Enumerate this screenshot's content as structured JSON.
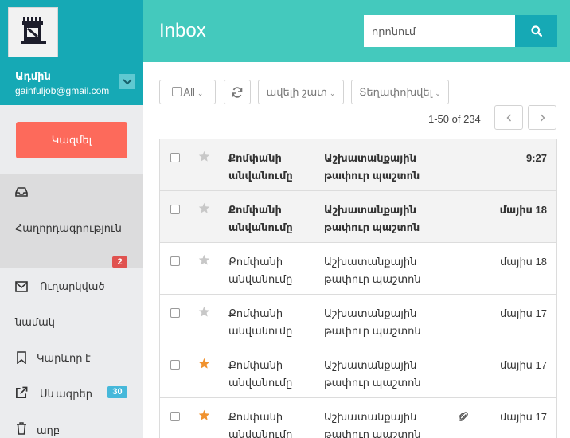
{
  "profile": {
    "name": "Ադմին",
    "email": "gainfuljob@gmail.com"
  },
  "compose": {
    "label": "Կազմել"
  },
  "nav": {
    "inbox": {
      "label": "Հաղորդագրություն",
      "badge": "2"
    },
    "sent": {
      "label_line1": "Ուղարկված",
      "label_line2": "նամակ"
    },
    "important": {
      "label": "Կարևոր է"
    },
    "drafts": {
      "label": "Սևագրեր",
      "badge": "30"
    },
    "trash": {
      "label": "աղբ"
    }
  },
  "header": {
    "title": "Inbox",
    "search_placeholder": "որոնում"
  },
  "toolbar": {
    "select_all_label": "All",
    "more_label": "ավելի շատ",
    "move_label": "Տեղափոխվել"
  },
  "pager": {
    "text": "1-50 of 234"
  },
  "mails": [
    {
      "sender_line1": "Քոմփանի",
      "sender_line2": "անվանումը",
      "subject_line1": "Աշխատանքային",
      "subject_line2": "թափուր պաշտոն",
      "date": "9:27",
      "unread": true,
      "starred": false,
      "attachment": false
    },
    {
      "sender_line1": "Քոմփանի",
      "sender_line2": "անվանումը",
      "subject_line1": "Աշխատանքային",
      "subject_line2": "թափուր պաշտոն",
      "date": "մայիս 18",
      "unread": true,
      "starred": false,
      "attachment": false
    },
    {
      "sender_line1": "Քոմփանի",
      "sender_line2": "անվանումը",
      "subject_line1": "Աշխատանքային",
      "subject_line2": "թափուր պաշտոն",
      "date": "մայիս 18",
      "unread": false,
      "starred": false,
      "attachment": false
    },
    {
      "sender_line1": "Քոմփանի",
      "sender_line2": "անվանումը",
      "subject_line1": "Աշխատանքային",
      "subject_line2": "թափուր պաշտոն",
      "date": "մայիս 17",
      "unread": false,
      "starred": false,
      "attachment": false
    },
    {
      "sender_line1": "Քոմփանի",
      "sender_line2": "անվանումը",
      "subject_line1": "Աշխատանքային",
      "subject_line2": "թափուր պաշտոն",
      "date": "մայիս 17",
      "unread": false,
      "starred": true,
      "attachment": false
    },
    {
      "sender_line1": "Քոմփանի",
      "sender_line2": "անվանումը",
      "subject_line1": "Աշխատանքային",
      "subject_line2": "թափուր պաշտոն",
      "date": "մայիս 17",
      "unread": false,
      "starred": true,
      "attachment": true
    }
  ],
  "colors": {
    "sidebar_profile": "#16a9b5",
    "header": "#44c9bd",
    "compose": "#fd6a5b",
    "badge_red": "#e0524f",
    "badge_blue": "#46b8da",
    "star_on": "#f0922f",
    "star_off": "#c8c8c8"
  },
  "icons": {
    "avatar": "building-logo-icon",
    "profile_toggle": "chevron-down-icon",
    "search": "search-icon",
    "refresh": "refresh-icon",
    "inbox": "inbox-tray-icon",
    "sent": "envelope-icon",
    "important": "bookmark-icon",
    "drafts": "external-link-icon",
    "trash": "trash-icon",
    "star": "star-icon",
    "attachment": "paperclip-icon",
    "pager_prev": "chevron-left-icon",
    "pager_next": "chevron-right-icon"
  }
}
